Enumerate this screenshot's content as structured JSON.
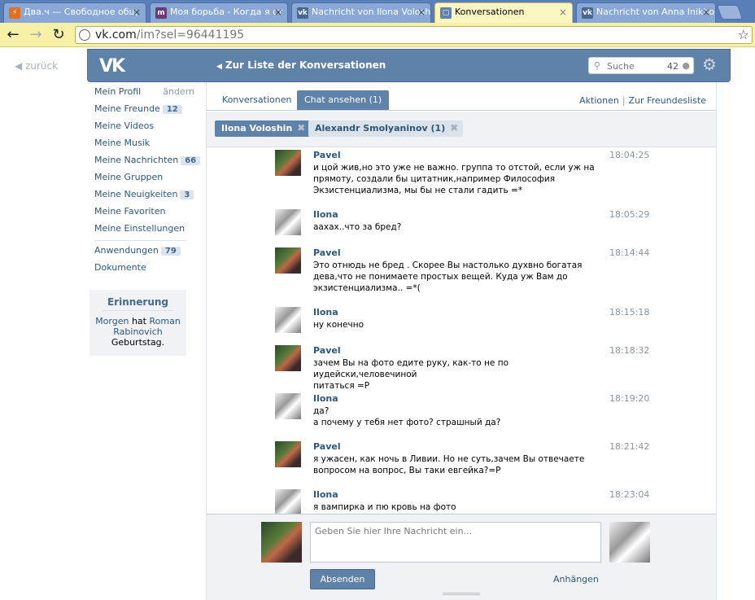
{
  "browser": {
    "tabs": [
      {
        "title": "Два.ч — Свободное общ",
        "fav": "⚡",
        "favColor": "#e07020",
        "active": false
      },
      {
        "title": "Моя борьба - Когда я ст",
        "fav": "m",
        "favColor": "#6a3a7a",
        "active": false
      },
      {
        "title": "Nachricht von Ilona Volosh",
        "fav": "vk",
        "favColor": "#45688e",
        "active": false
      },
      {
        "title": "Konversationen",
        "fav": "▢",
        "favColor": "#5f82a9",
        "active": true
      },
      {
        "title": "Nachricht von Anna Inikho",
        "fav": "vk",
        "favColor": "#45688e",
        "active": false
      }
    ],
    "url_domain": "vk.com",
    "url_path": "/im?sel=96441195"
  },
  "header": {
    "back_label": "zurück",
    "logo": "VK",
    "to_list_label": "Zur Liste der Konversationen",
    "search_placeholder": "Suche",
    "search_count": "42"
  },
  "sidebar": {
    "profile": {
      "label": "Mein Profil",
      "edit": "ändern"
    },
    "items": [
      {
        "label": "Meine Freunde",
        "badge": "12"
      },
      {
        "label": "Meine Videos",
        "badge": ""
      },
      {
        "label": "Meine Musik",
        "badge": ""
      },
      {
        "label": "Meine Nachrichten",
        "badge": "66"
      },
      {
        "label": "Meine Gruppen",
        "badge": ""
      },
      {
        "label": "Meine Neuigkeiten",
        "badge": "3"
      },
      {
        "label": "Meine Favoriten",
        "badge": ""
      },
      {
        "label": "Meine Einstellungen",
        "badge": ""
      }
    ],
    "apps": [
      {
        "label": "Anwendungen",
        "badge": "79"
      },
      {
        "label": "Dokumente",
        "badge": ""
      }
    ],
    "reminder": {
      "title": "Erinnerung",
      "pre": "Morgen",
      "mid": " hat ",
      "name": "Roman Rabinovich",
      "post": " Geburtstag."
    }
  },
  "main": {
    "tabs": [
      {
        "label": "Konversationen",
        "selected": false
      },
      {
        "label": "Chat ansehen (1)",
        "selected": true
      }
    ],
    "links": {
      "actions": "Aktionen",
      "friends": "Zur Freundesliste"
    },
    "chips": [
      {
        "label": "Ilona Voloshin",
        "active": true
      },
      {
        "label": "Alexandr Smolyaninov (1)",
        "active": false
      }
    ],
    "messages": [
      {
        "author": "Pavel",
        "time": "18:04:25",
        "lines": [
          "и цой жив,но это уже не важно. группа то отстой, если уж на",
          "прямоту, создали бы цитатник,например Философия",
          "Экзистенциализма, мы бы не стали гадить =*"
        ]
      },
      {
        "author": "Ilona",
        "time": "18:05:29",
        "lines": [
          "аахах..что за бред?"
        ]
      },
      {
        "author": "Pavel",
        "time": "18:14:44",
        "lines": [
          "Это отнюдь не бред . Скорее Вы настолько духвно богатая",
          "дева,что не понимаете простых вещей. Куда уж Вам до",
          "экзистенциализма.. =*("
        ]
      },
      {
        "author": "Ilona",
        "time": "18:15:18",
        "lines": [
          "ну конечно"
        ]
      },
      {
        "author": "Pavel",
        "time": "18:18:32",
        "lines": [
          "зачем Вы на фото едите руку, как-то не по иудейски,человечиной",
          "питаться =Р"
        ]
      },
      {
        "author": "Ilona",
        "time": "18:19:20",
        "lines": [
          "да?",
          "а почему у тебя нет фото? страшный да?"
        ]
      },
      {
        "author": "Pavel",
        "time": "18:21:42",
        "lines": [
          "я ужасен, как ночь в Ливии. Но не суть,зачем Вы отвечаете",
          "вопросом на вопрос, Вы таки евгейка?=Р"
        ]
      },
      {
        "author": "Ilona",
        "time": "18:23:04",
        "lines": [
          "я вампирка и пю кровь на фото"
        ]
      }
    ],
    "composer": {
      "placeholder": "Geben Sie hier Ihre Nachricht ein...",
      "send_label": "Absenden",
      "attach_label": "Anhängen"
    }
  }
}
